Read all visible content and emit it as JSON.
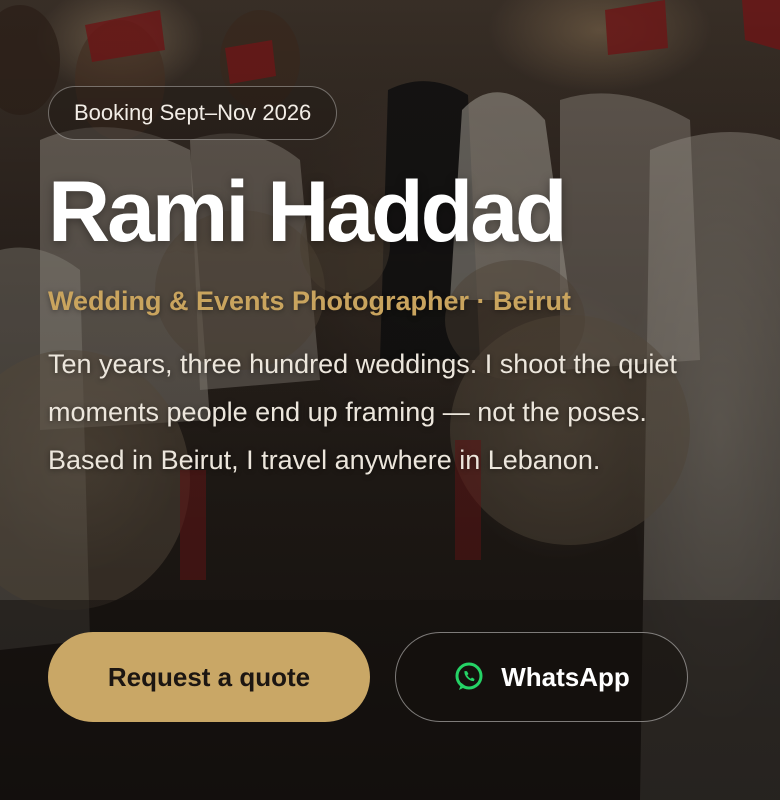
{
  "hero": {
    "badge": "Booking Sept–Nov 2026",
    "name": "Rami Haddad",
    "tagline": "Wedding & Events Photographer · Beirut",
    "description": "Ten years, three hundred weddings. I shoot the quiet moments people end up framing — not the poses. Based in Beirut, I travel anywhere in Lebanon.",
    "primary_button": "Request a quote",
    "secondary_button": "WhatsApp",
    "secondary_icon": "whatsapp-icon"
  },
  "colors": {
    "accent": "#c9a45e",
    "button_primary_bg": "#c9a766",
    "whatsapp_green": "#25d366"
  }
}
